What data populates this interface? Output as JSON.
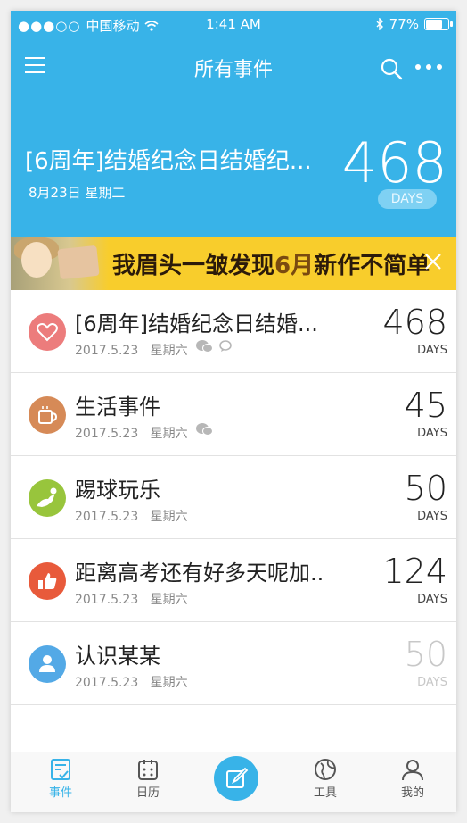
{
  "status_bar": {
    "carrier": "中国移动",
    "signal_dots": "●●●○○",
    "time": "1:41 AM",
    "battery": "77%"
  },
  "nav": {
    "title": "所有事件"
  },
  "hero": {
    "title": "[6周年]结婚纪念日结婚纪...",
    "date": "8月23日 星期二",
    "count": "468",
    "unit": "DAYS"
  },
  "banner": {
    "text_pre": "我眉头一皱发现",
    "text_six": "6月",
    "text_post": "新作不简单"
  },
  "events": [
    {
      "icon": "heart-icon",
      "color": "#ec7c7c",
      "title": "[6周年]结婚纪念日结婚...",
      "date": "2017.5.23",
      "weekday": "星期六",
      "count": "468",
      "unit": "DAYS",
      "muted": false
    },
    {
      "icon": "cup-icon",
      "color": "#d68a57",
      "title": "生活事件",
      "date": "2017.5.23",
      "weekday": "星期六",
      "count": "45",
      "unit": "DAYS",
      "muted": false
    },
    {
      "icon": "soccer-icon",
      "color": "#98c53c",
      "title": "踢球玩乐",
      "date": "2017.5.23",
      "weekday": "星期六",
      "count": "50",
      "unit": "DAYS",
      "muted": false
    },
    {
      "icon": "thumbs-up-icon",
      "color": "#e85a3b",
      "title": "距离高考还有好多天呢加..",
      "date": "2017.5.23",
      "weekday": "星期六",
      "count": "124",
      "unit": "DAYS",
      "muted": false
    },
    {
      "icon": "person-icon",
      "color": "#53a9e6",
      "title": "认识某某",
      "date": "2017.5.23",
      "weekday": "星期六",
      "count": "50",
      "unit": "DAYS",
      "muted": true
    }
  ],
  "tabs": [
    {
      "label": "事件",
      "icon": "events-icon",
      "active": true
    },
    {
      "label": "日历",
      "icon": "calendar-icon",
      "active": false
    },
    {
      "label": "",
      "icon": "edit-icon",
      "active": false
    },
    {
      "label": "工具",
      "icon": "globe-icon",
      "active": false
    },
    {
      "label": "我的",
      "icon": "profile-icon",
      "active": false
    }
  ],
  "colors": {
    "primary": "#38b3e8",
    "muted_text": "#c8c8c8"
  }
}
